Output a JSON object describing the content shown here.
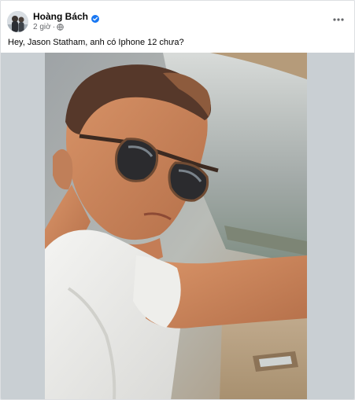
{
  "post": {
    "author_name": "Hoàng Bách",
    "timestamp": "2 giờ",
    "separator": "·",
    "caption": "Hey, Jason Statham, anh có Iphone 12 chưa?"
  },
  "icons": {
    "verified": "verified-badge-icon",
    "privacy": "globe-icon",
    "more": "more-options-icon"
  },
  "colors": {
    "verified_blue": "#1877f2",
    "secondary_text": "#65676b",
    "primary_text": "#050505"
  }
}
